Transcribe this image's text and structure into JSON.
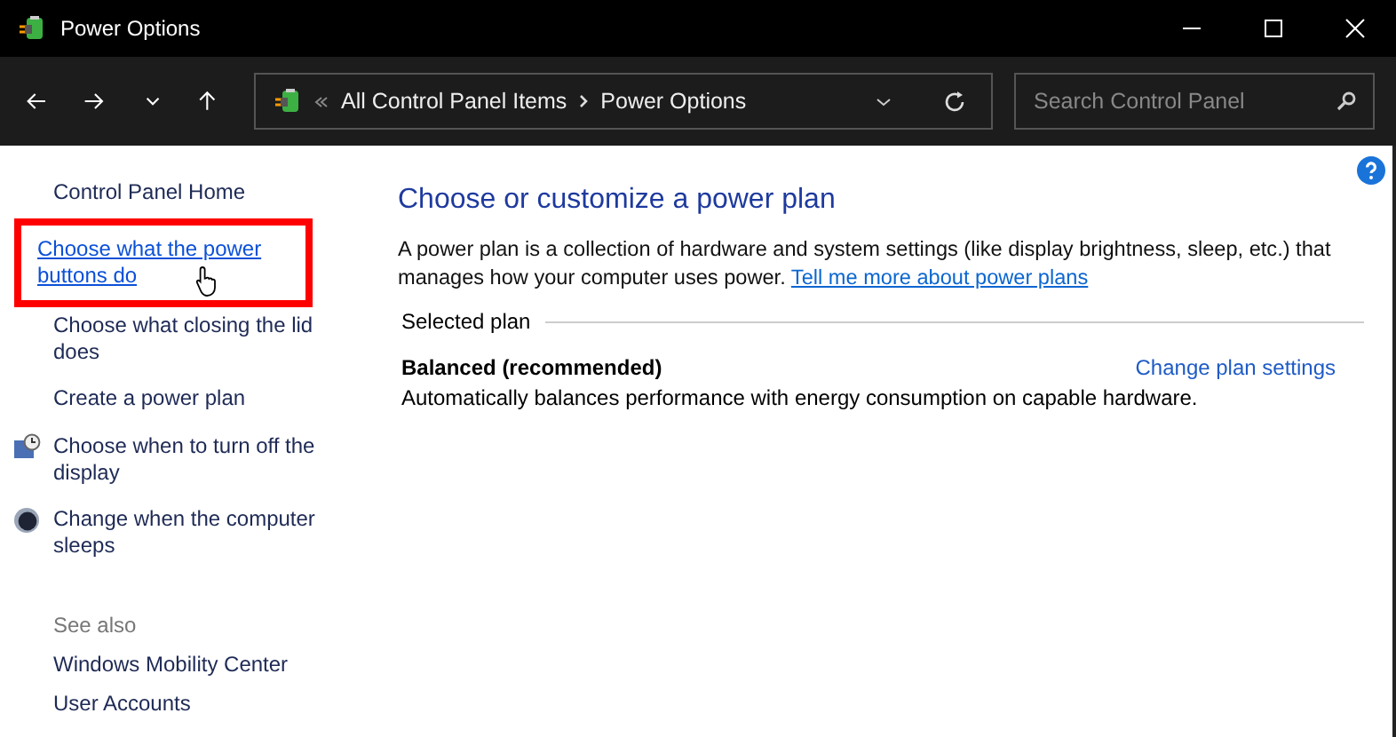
{
  "window": {
    "title": "Power Options"
  },
  "address": {
    "breadcrumbs": [
      "All Control Panel Items",
      "Power Options"
    ]
  },
  "search": {
    "placeholder": "Search Control Panel"
  },
  "sidebar": {
    "items": [
      {
        "label": "Control Panel Home",
        "kind": "plain",
        "hovered": false,
        "highlighted": false
      },
      {
        "label": "Choose what the power buttons do",
        "kind": "plain",
        "hovered": true,
        "highlighted": true
      },
      {
        "label": "Choose what closing the lid does",
        "kind": "plain",
        "hovered": false,
        "highlighted": false
      },
      {
        "label": "Create a power plan",
        "kind": "plain",
        "hovered": false,
        "highlighted": false
      },
      {
        "label": "Choose when to turn off the display",
        "kind": "display",
        "hovered": false,
        "highlighted": false
      },
      {
        "label": "Change when the computer sleeps",
        "kind": "sleep",
        "hovered": false,
        "highlighted": false
      }
    ],
    "see_also": {
      "heading": "See also",
      "items": [
        "Windows Mobility Center",
        "User Accounts"
      ]
    }
  },
  "main": {
    "heading": "Choose or customize a power plan",
    "description": "A power plan is a collection of hardware and system settings (like display brightness, sleep, etc.) that manages how your computer uses power.",
    "link": "Tell me more about power plans",
    "section": "Selected plan",
    "plan": {
      "name": "Balanced (recommended)",
      "action": "Change plan settings",
      "description": "Automatically balances performance with energy consumption on capable hardware."
    }
  }
}
